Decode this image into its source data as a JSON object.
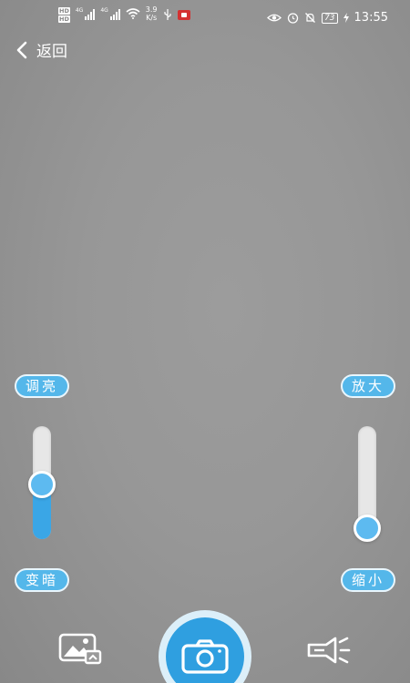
{
  "status_bar": {
    "hd_1": "HD",
    "hd_2": "HD",
    "network_1": "4G",
    "network_2": "4G",
    "speed_value": "3.9",
    "speed_unit": "K/s",
    "battery": "73",
    "time": "13:55"
  },
  "nav": {
    "back_label": "返回"
  },
  "brightness": {
    "top_label": "调亮",
    "bottom_label": "变暗",
    "level_percent": 48
  },
  "zoom": {
    "top_label": "放大",
    "bottom_label": "缩小",
    "level_percent": 0
  },
  "bottom_bar": {
    "gallery_icon": "gallery-icon",
    "shutter_icon": "camera-icon",
    "flash_icon": "flashlight-icon"
  },
  "colors": {
    "accent": "#54b7ea",
    "slider_fill": "#3aa6e6",
    "shutter": "#2f9fe0",
    "record_badge": "#d43131"
  }
}
